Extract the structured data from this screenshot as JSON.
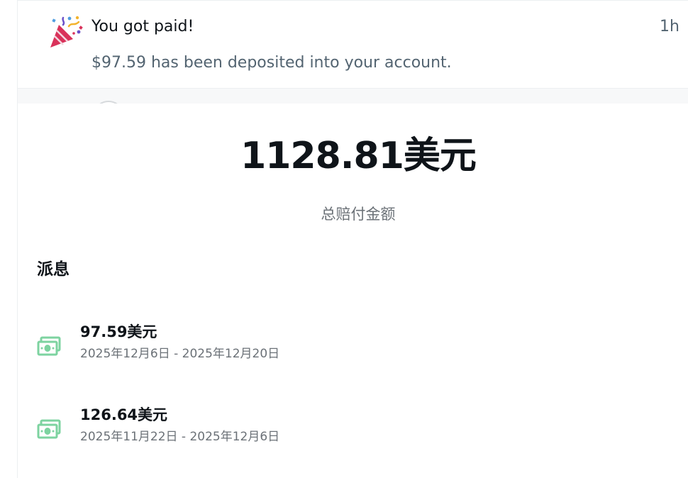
{
  "notification": {
    "icon": "party-popper-icon",
    "title": "You got paid!",
    "time": "1h",
    "body": "$97.59 has been deposited into your account."
  },
  "summary": {
    "total_amount": "1128.81美元",
    "total_label": "总赔付金额"
  },
  "payouts": {
    "heading": "派息",
    "items": [
      {
        "icon": "money-bill-icon",
        "amount": "97.59美元",
        "range": "2025年12月6日 - 2025年12月20日"
      },
      {
        "icon": "money-bill-icon",
        "amount": "126.64美元",
        "range": "2025年11月22日 - 2025年12月6日"
      }
    ]
  },
  "colors": {
    "money_icon": "#7dd3a0",
    "text_primary": "#0f1419",
    "text_secondary": "#536471"
  }
}
